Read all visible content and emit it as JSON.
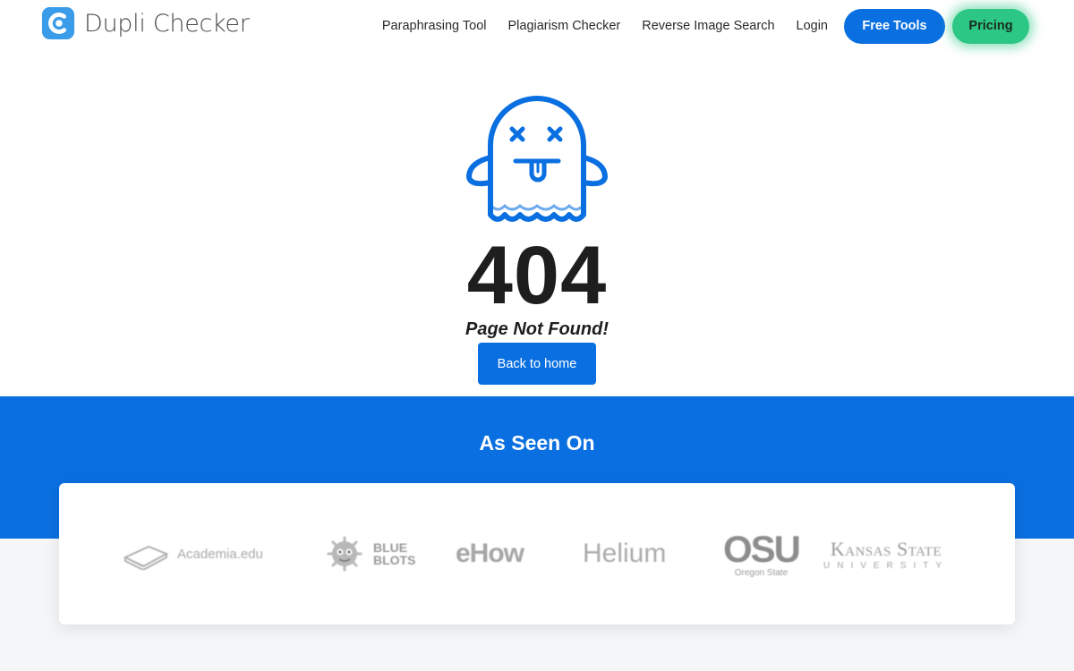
{
  "brand": {
    "name": "Dupli Checker",
    "color": "#0a6fe0"
  },
  "nav": {
    "links": [
      "Paraphrasing Tool",
      "Plagiarism Checker",
      "Reverse Image Search",
      "Login"
    ],
    "free_tools_label": "Free Tools",
    "pricing_label": "Pricing",
    "pricing_color": "#2cc784"
  },
  "error": {
    "code": "404",
    "message": "Page Not Found!",
    "back_home_label": "Back to home",
    "icon": "dead-ghost-icon"
  },
  "as_seen_on": {
    "title": "As Seen On",
    "logos": {
      "academia": "Academia.edu",
      "blueblots_top": "BLUE",
      "blueblots_bottom": "BLOTS",
      "ehow": "eHow",
      "helium": "Helium",
      "osu_big": "OSU",
      "osu_small": "Oregon State",
      "kstate_big": "Kansas State",
      "kstate_small": "UNIVERSITY"
    }
  }
}
